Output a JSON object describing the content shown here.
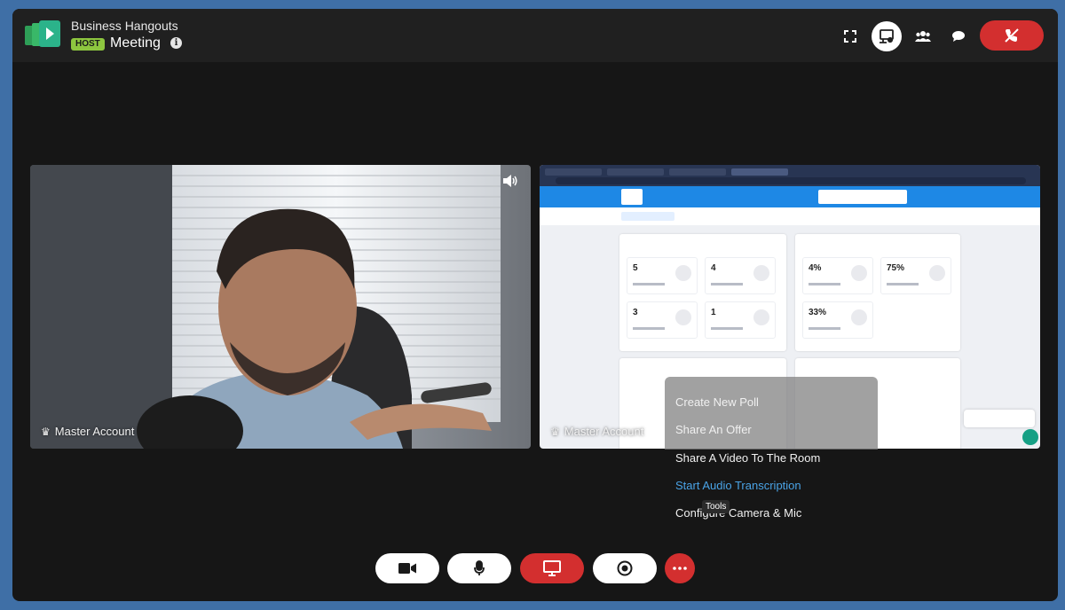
{
  "header": {
    "app_name": "Business Hangouts",
    "role_badge": "HOST",
    "meeting_title": "Meeting",
    "info_icon": "i",
    "icons": [
      "fullscreen-icon",
      "screen-share-icon",
      "participants-icon",
      "chat-icon",
      "leave-call-icon"
    ],
    "leave_color": "#d32f2f",
    "badge_color": "#8dc63f"
  },
  "tiles": [
    {
      "participant": "Master Account",
      "icon": "crown-icon",
      "audio_icon": "speaker-icon"
    },
    {
      "participant": "Master Account",
      "icon": "crown-icon"
    }
  ],
  "tools_menu": {
    "items": [
      {
        "label": "Create New Poll"
      },
      {
        "label": "Share An Offer"
      },
      {
        "label": "Share A Video To The Room"
      },
      {
        "label": "Start Audio Transcription",
        "accent": "#4aa3e6"
      },
      {
        "label": "Configure Camera & Mic"
      }
    ],
    "tooltip": "Tools"
  },
  "controls": {
    "icons": [
      "camera-icon",
      "microphone-icon",
      "screen-share-icon",
      "record-icon",
      "more-icon"
    ],
    "active_color": "#d32f2f"
  },
  "shared_screen": {
    "stats_left": [
      "5",
      "4",
      "3",
      "1"
    ],
    "stats_right": [
      "4%",
      "75%",
      "33%"
    ]
  }
}
